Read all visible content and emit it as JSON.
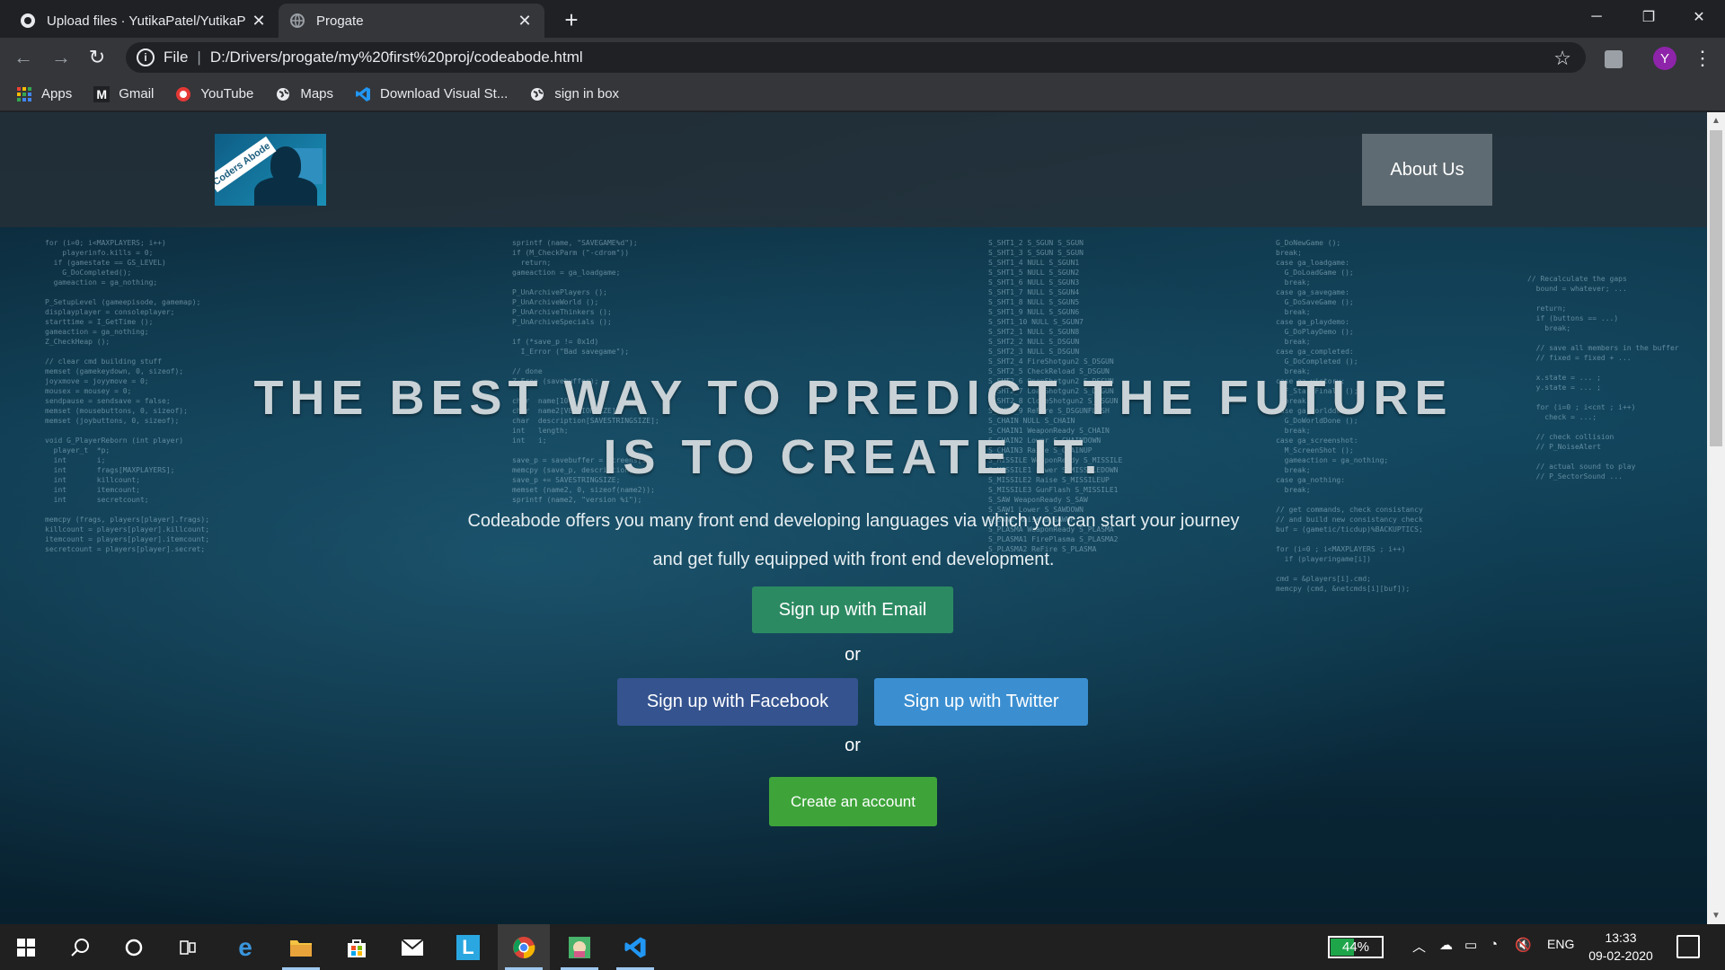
{
  "browser": {
    "tabs": [
      {
        "title": "Upload files · YutikaPatel/YutikaP",
        "favicon": "github-icon",
        "active": false
      },
      {
        "title": "Progate",
        "favicon": "globe-icon",
        "active": true
      }
    ],
    "new_tab": "+",
    "address": {
      "scheme": "File",
      "url": "D:/Drivers/progate/my%20first%20proj/codeabode.html"
    },
    "profile_initial": "Y",
    "bookmarks": [
      {
        "label": "Apps",
        "icon": "apps-grid-icon"
      },
      {
        "label": "Gmail",
        "icon": "gmail-icon"
      },
      {
        "label": "YouTube",
        "icon": "youtube-icon"
      },
      {
        "label": "Maps",
        "icon": "globe-icon"
      },
      {
        "label": "Download Visual St...",
        "icon": "vscode-icon"
      },
      {
        "label": "sign in box",
        "icon": "globe-icon"
      }
    ]
  },
  "page": {
    "logo_text": "Coders Abode",
    "nav": {
      "about": "About Us"
    },
    "hero": {
      "title_line1": "THE BEST WAY TO PREDICT THE FUTURE",
      "title_line2": "IS TO CREATE IT.",
      "desc_line1": "Codeabode offers you many front end developing languages via which you can start your journey",
      "desc_line2": "and get fully equipped with front end development."
    },
    "buttons": {
      "email": "Sign up with Email",
      "or1": "or",
      "facebook": "Sign up with Facebook",
      "twitter": "Sign up with Twitter",
      "or2": "or",
      "create": "Create an account"
    },
    "colors": {
      "email": "#2c8a62",
      "facebook": "#34538f",
      "twitter": "#3b8fd1",
      "create": "#3ea43a",
      "header": "#283037"
    }
  },
  "taskbar": {
    "battery_percent": "44%",
    "battery_level": 0.44,
    "language": "ENG",
    "time": "13:33",
    "date": "09-02-2020",
    "apps": [
      "windows-icon",
      "search-icon",
      "cortana-icon",
      "task-view-icon",
      "edge-icon",
      "file-explorer-icon",
      "store-icon",
      "mail-icon",
      "l-app-icon",
      "chrome-icon",
      "game-icon",
      "vscode-icon"
    ]
  }
}
